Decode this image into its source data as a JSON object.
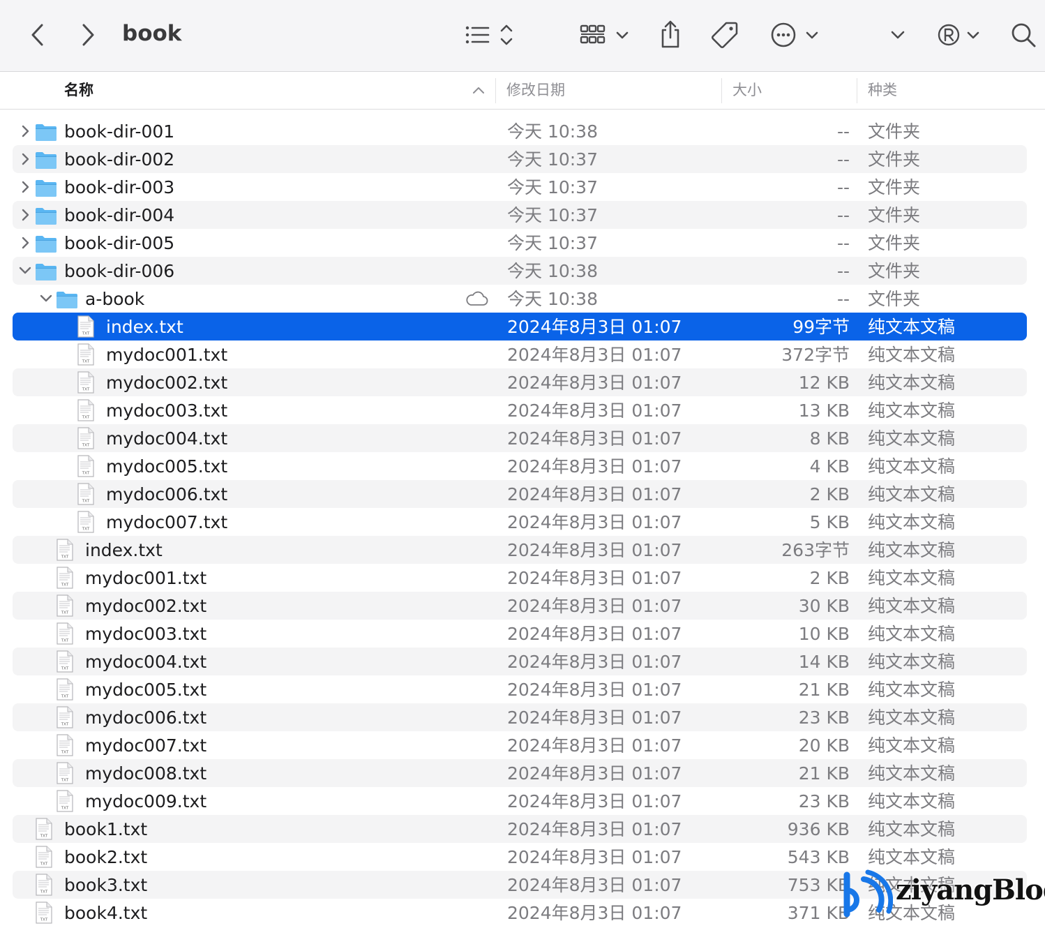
{
  "window": {
    "title": "book"
  },
  "toolbar": {
    "back_icon": "chevron-left-icon",
    "forward_icon": "chevron-right-icon",
    "view_list_icon": "list-view-icon",
    "group_icon": "grid-group-icon",
    "share_icon": "share-icon",
    "tag_icon": "tag-icon",
    "more_icon": "ellipsis-circle-icon",
    "registered_icon": "registered-icon",
    "search_icon": "search-icon"
  },
  "columns": {
    "name": "名称",
    "date": "修改日期",
    "size": "大小",
    "kind": "种类"
  },
  "colors": {
    "selection": "#0a63e8",
    "folder": "#5ab6f2",
    "alt_row": "#f4f4f5"
  },
  "rows": [
    {
      "name": "book-dir-001",
      "date": "今天 10:38",
      "size": "--",
      "kind": "文件夹",
      "type": "folder",
      "level": 0,
      "disclosure": "collapsed",
      "alt": false,
      "selected": false
    },
    {
      "name": "book-dir-002",
      "date": "今天 10:37",
      "size": "--",
      "kind": "文件夹",
      "type": "folder",
      "level": 0,
      "disclosure": "collapsed",
      "alt": true,
      "selected": false
    },
    {
      "name": "book-dir-003",
      "date": "今天 10:37",
      "size": "--",
      "kind": "文件夹",
      "type": "folder",
      "level": 0,
      "disclosure": "collapsed",
      "alt": false,
      "selected": false
    },
    {
      "name": "book-dir-004",
      "date": "今天 10:37",
      "size": "--",
      "kind": "文件夹",
      "type": "folder",
      "level": 0,
      "disclosure": "collapsed",
      "alt": true,
      "selected": false
    },
    {
      "name": "book-dir-005",
      "date": "今天 10:37",
      "size": "--",
      "kind": "文件夹",
      "type": "folder",
      "level": 0,
      "disclosure": "collapsed",
      "alt": false,
      "selected": false
    },
    {
      "name": "book-dir-006",
      "date": "今天 10:38",
      "size": "--",
      "kind": "文件夹",
      "type": "folder",
      "level": 0,
      "disclosure": "expanded",
      "alt": true,
      "selected": false
    },
    {
      "name": "a-book",
      "date": "今天 10:38",
      "size": "--",
      "kind": "文件夹",
      "type": "folder",
      "level": 1,
      "disclosure": "expanded",
      "alt": false,
      "selected": false,
      "cloud": true
    },
    {
      "name": "index.txt",
      "date": "2024年8月3日 01:07",
      "size": "99字节",
      "kind": "纯文本文稿",
      "type": "txt",
      "level": 2,
      "alt": true,
      "selected": true
    },
    {
      "name": "mydoc001.txt",
      "date": "2024年8月3日 01:07",
      "size": "372字节",
      "kind": "纯文本文稿",
      "type": "txt",
      "level": 2,
      "alt": false,
      "selected": false
    },
    {
      "name": "mydoc002.txt",
      "date": "2024年8月3日 01:07",
      "size": "12 KB",
      "kind": "纯文本文稿",
      "type": "txt",
      "level": 2,
      "alt": true,
      "selected": false
    },
    {
      "name": "mydoc003.txt",
      "date": "2024年8月3日 01:07",
      "size": "13 KB",
      "kind": "纯文本文稿",
      "type": "txt",
      "level": 2,
      "alt": false,
      "selected": false
    },
    {
      "name": "mydoc004.txt",
      "date": "2024年8月3日 01:07",
      "size": "8 KB",
      "kind": "纯文本文稿",
      "type": "txt",
      "level": 2,
      "alt": true,
      "selected": false
    },
    {
      "name": "mydoc005.txt",
      "date": "2024年8月3日 01:07",
      "size": "4 KB",
      "kind": "纯文本文稿",
      "type": "txt",
      "level": 2,
      "alt": false,
      "selected": false
    },
    {
      "name": "mydoc006.txt",
      "date": "2024年8月3日 01:07",
      "size": "2 KB",
      "kind": "纯文本文稿",
      "type": "txt",
      "level": 2,
      "alt": true,
      "selected": false
    },
    {
      "name": "mydoc007.txt",
      "date": "2024年8月3日 01:07",
      "size": "5 KB",
      "kind": "纯文本文稿",
      "type": "txt",
      "level": 2,
      "alt": false,
      "selected": false
    },
    {
      "name": "index.txt",
      "date": "2024年8月3日 01:07",
      "size": "263字节",
      "kind": "纯文本文稿",
      "type": "txt",
      "level": 1,
      "alt": true,
      "selected": false
    },
    {
      "name": "mydoc001.txt",
      "date": "2024年8月3日 01:07",
      "size": "2 KB",
      "kind": "纯文本文稿",
      "type": "txt",
      "level": 1,
      "alt": false,
      "selected": false
    },
    {
      "name": "mydoc002.txt",
      "date": "2024年8月3日 01:07",
      "size": "30 KB",
      "kind": "纯文本文稿",
      "type": "txt",
      "level": 1,
      "alt": true,
      "selected": false
    },
    {
      "name": "mydoc003.txt",
      "date": "2024年8月3日 01:07",
      "size": "10 KB",
      "kind": "纯文本文稿",
      "type": "txt",
      "level": 1,
      "alt": false,
      "selected": false
    },
    {
      "name": "mydoc004.txt",
      "date": "2024年8月3日 01:07",
      "size": "14 KB",
      "kind": "纯文本文稿",
      "type": "txt",
      "level": 1,
      "alt": true,
      "selected": false
    },
    {
      "name": "mydoc005.txt",
      "date": "2024年8月3日 01:07",
      "size": "21 KB",
      "kind": "纯文本文稿",
      "type": "txt",
      "level": 1,
      "alt": false,
      "selected": false
    },
    {
      "name": "mydoc006.txt",
      "date": "2024年8月3日 01:07",
      "size": "23 KB",
      "kind": "纯文本文稿",
      "type": "txt",
      "level": 1,
      "alt": true,
      "selected": false
    },
    {
      "name": "mydoc007.txt",
      "date": "2024年8月3日 01:07",
      "size": "20 KB",
      "kind": "纯文本文稿",
      "type": "txt",
      "level": 1,
      "alt": false,
      "selected": false
    },
    {
      "name": "mydoc008.txt",
      "date": "2024年8月3日 01:07",
      "size": "21 KB",
      "kind": "纯文本文稿",
      "type": "txt",
      "level": 1,
      "alt": true,
      "selected": false
    },
    {
      "name": "mydoc009.txt",
      "date": "2024年8月3日 01:07",
      "size": "23 KB",
      "kind": "纯文本文稿",
      "type": "txt",
      "level": 1,
      "alt": false,
      "selected": false
    },
    {
      "name": "book1.txt",
      "date": "2024年8月3日 01:07",
      "size": "936 KB",
      "kind": "纯文本文稿",
      "type": "txt",
      "level": 0,
      "alt": true,
      "selected": false
    },
    {
      "name": "book2.txt",
      "date": "2024年8月3日 01:07",
      "size": "543 KB",
      "kind": "纯文本文稿",
      "type": "txt",
      "level": 0,
      "alt": false,
      "selected": false
    },
    {
      "name": "book3.txt",
      "date": "2024年8月3日 01:07",
      "size": "753 KB",
      "kind": "纯文本文稿",
      "type": "txt",
      "level": 0,
      "alt": true,
      "selected": false
    },
    {
      "name": "book4.txt",
      "date": "2024年8月3日 01:07",
      "size": "371 KB",
      "kind": "纯文本文稿",
      "type": "txt",
      "level": 0,
      "alt": false,
      "selected": false
    }
  ],
  "watermark": {
    "text": "ziyangBlog"
  }
}
